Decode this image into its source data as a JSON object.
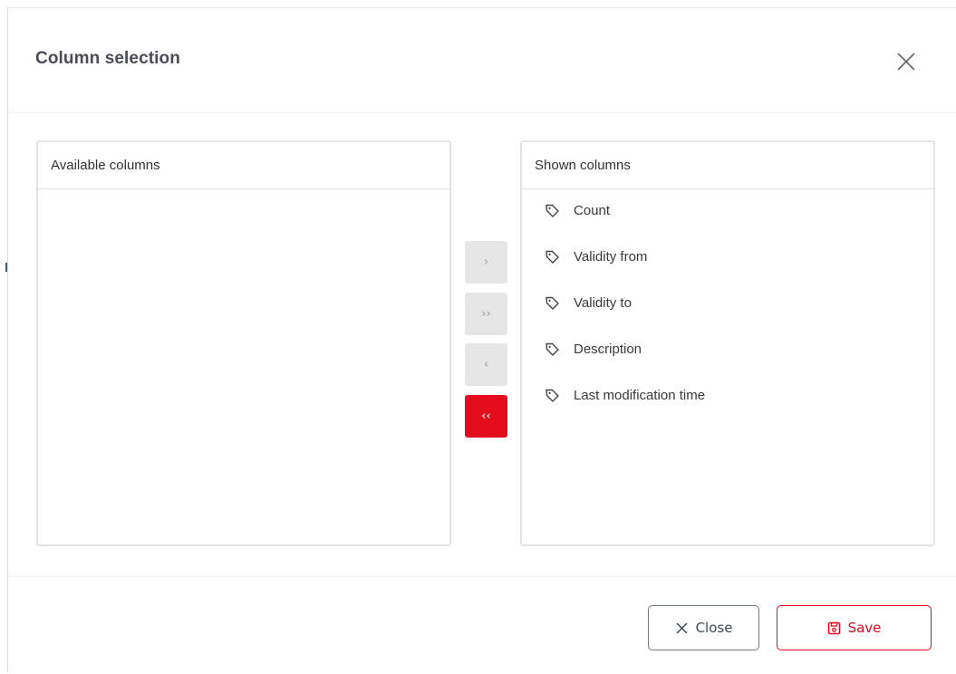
{
  "dialog": {
    "title": "Column selection"
  },
  "available_panel": {
    "title": "Available columns",
    "items": []
  },
  "shown_panel": {
    "title": "Shown columns",
    "items": [
      "Count",
      "Validity from",
      "Validity to",
      "Description",
      "Last modification time"
    ]
  },
  "movers": {
    "move_right": "›",
    "move_all_right": "››",
    "move_left": "‹",
    "move_all_left": "‹‹"
  },
  "footer": {
    "close_label": "Close",
    "save_label": "Save"
  },
  "colors": {
    "accent": "#e30b1c",
    "disabled_button": "#e6e6e6",
    "panel_border": "#e2e4e8"
  },
  "icons": {
    "close": "close-icon",
    "item": "tag-icon",
    "save": "floppy-disk-icon"
  }
}
